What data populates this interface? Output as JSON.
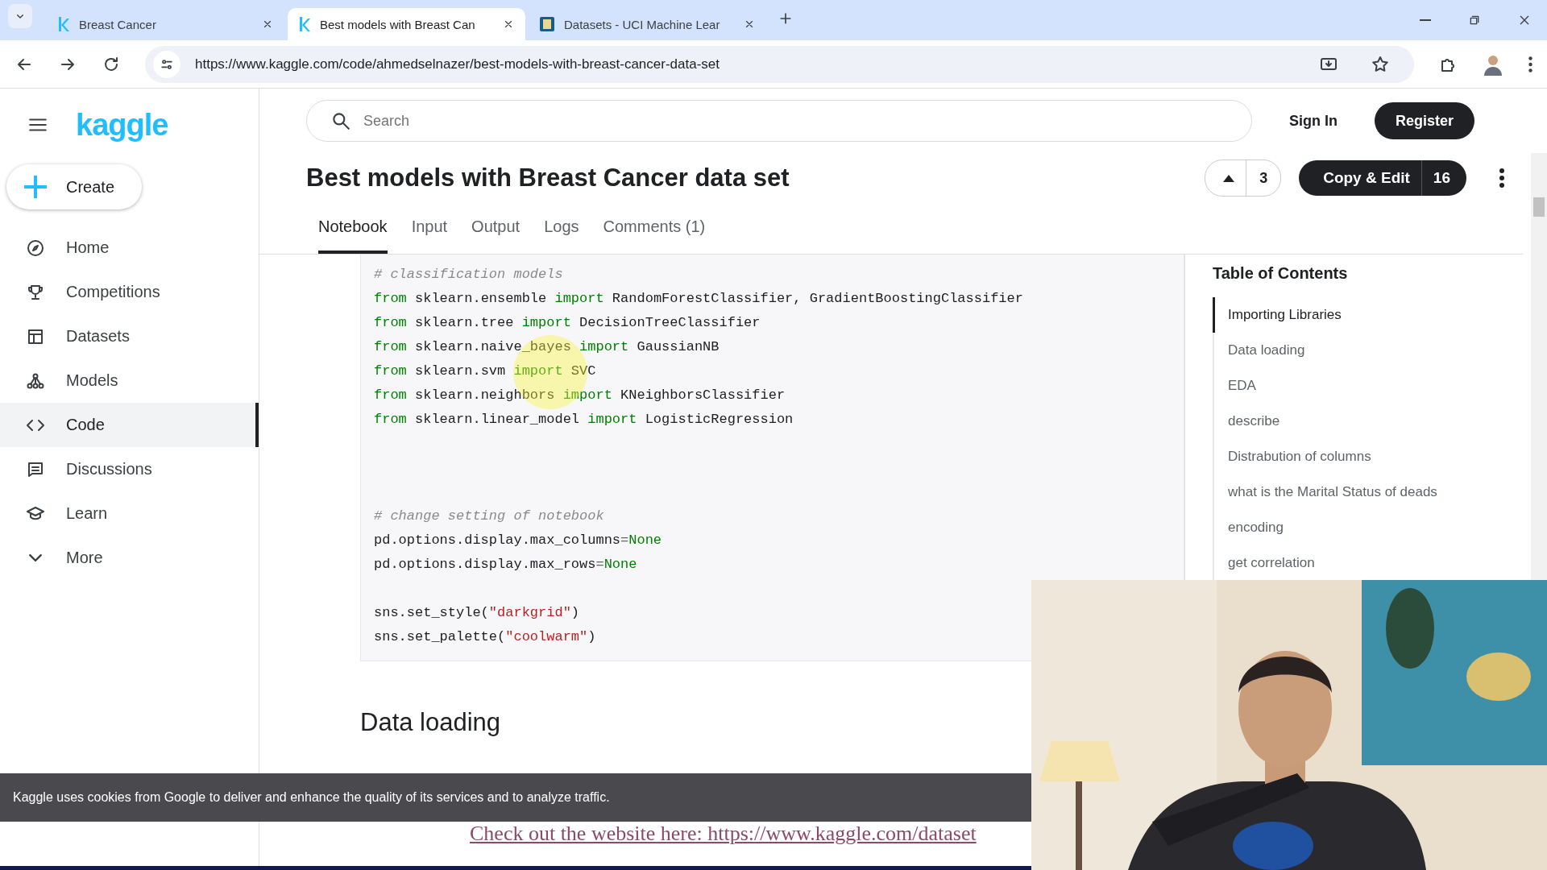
{
  "browser": {
    "tabs": [
      {
        "title": "Breast Cancer",
        "selected": false
      },
      {
        "title": "Best models with Breast Can",
        "selected": true
      },
      {
        "title": "Datasets - UCI Machine Lear",
        "selected": false
      }
    ],
    "url": "https://www.kaggle.com/code/ahmedselnazer/best-models-with-breast-cancer-data-set"
  },
  "sidebar": {
    "logo": "kaggle",
    "create": "Create",
    "items": [
      {
        "label": "Home",
        "selected": false
      },
      {
        "label": "Competitions",
        "selected": false
      },
      {
        "label": "Datasets",
        "selected": false
      },
      {
        "label": "Models",
        "selected": false
      },
      {
        "label": "Code",
        "selected": true
      },
      {
        "label": "Discussions",
        "selected": false
      },
      {
        "label": "Learn",
        "selected": false
      },
      {
        "label": "More",
        "selected": false
      }
    ]
  },
  "header": {
    "search": {
      "placeholder": "Search"
    },
    "sign_in": "Sign In",
    "register": "Register"
  },
  "notebook": {
    "title": "Best models with Breast Cancer data set",
    "votes": "3",
    "copy_edit": "Copy & Edit",
    "copies": "16",
    "tabs": [
      {
        "label": "Notebook",
        "selected": true
      },
      {
        "label": "Input",
        "selected": false
      },
      {
        "label": "Output",
        "selected": false
      },
      {
        "label": "Logs",
        "selected": false
      },
      {
        "label": "Comments (1)",
        "selected": false
      }
    ],
    "code_groups": [
      [
        [
          {
            "kind": "comment",
            "text": "# classification models"
          }
        ],
        [
          {
            "kind": "keyword",
            "text": "from"
          },
          {
            "kind": "plain",
            "text": " sklearn.ensemble "
          },
          {
            "kind": "keyword",
            "text": "import"
          },
          {
            "kind": "plain",
            "text": " RandomForestClassifier, GradientBoostingClassifier"
          }
        ],
        [
          {
            "kind": "keyword",
            "text": "from"
          },
          {
            "kind": "plain",
            "text": " sklearn.tree "
          },
          {
            "kind": "keyword",
            "text": "import"
          },
          {
            "kind": "plain",
            "text": " DecisionTreeClassifier"
          }
        ],
        [
          {
            "kind": "keyword",
            "text": "from"
          },
          {
            "kind": "plain",
            "text": " sklearn.naive_bayes "
          },
          {
            "kind": "keyword",
            "text": "import"
          },
          {
            "kind": "plain",
            "text": " GaussianNB"
          }
        ],
        [
          {
            "kind": "keyword",
            "text": "from"
          },
          {
            "kind": "plain",
            "text": " sklearn.svm "
          },
          {
            "kind": "keyword",
            "text": "import"
          },
          {
            "kind": "plain",
            "text": " SVC"
          }
        ],
        [
          {
            "kind": "keyword",
            "text": "from"
          },
          {
            "kind": "plain",
            "text": " sklearn.neighbors "
          },
          {
            "kind": "keyword",
            "text": "import"
          },
          {
            "kind": "plain",
            "text": " KNeighborsClassifier"
          }
        ],
        [
          {
            "kind": "keyword",
            "text": "from"
          },
          {
            "kind": "plain",
            "text": " sklearn.linear_model "
          },
          {
            "kind": "keyword",
            "text": "import"
          },
          {
            "kind": "plain",
            "text": " LogisticRegression"
          }
        ]
      ],
      [
        [
          {
            "kind": "comment",
            "text": "# change setting of notebook"
          }
        ],
        [
          {
            "kind": "plain",
            "text": "pd.options.display.max_columns"
          },
          {
            "kind": "operator",
            "text": "="
          },
          {
            "kind": "keyword",
            "text": "None"
          }
        ],
        [
          {
            "kind": "plain",
            "text": "pd.options.display.max_rows"
          },
          {
            "kind": "operator",
            "text": "="
          },
          {
            "kind": "keyword",
            "text": "None"
          }
        ]
      ],
      [
        [
          {
            "kind": "plain",
            "text": "sns.set_style("
          },
          {
            "kind": "string",
            "text": "\"darkgrid\""
          },
          {
            "kind": "plain",
            "text": ")"
          }
        ],
        [
          {
            "kind": "plain",
            "text": "sns.set_palette("
          },
          {
            "kind": "string",
            "text": "\"coolwarm\""
          },
          {
            "kind": "plain",
            "text": ")"
          }
        ]
      ]
    ],
    "section_heading": "Data loading",
    "toc": {
      "title": "Table of Contents",
      "items": [
        {
          "label": "Importing Libraries",
          "selected": true
        },
        {
          "label": "Data loading",
          "selected": false
        },
        {
          "label": "EDA",
          "selected": false
        },
        {
          "label": "describe",
          "selected": false
        },
        {
          "label": "Distrabution of columns",
          "selected": false
        },
        {
          "label": "what is the Marital Status of deads",
          "selected": false
        },
        {
          "label": "encoding",
          "selected": false
        },
        {
          "label": "get correlation",
          "selected": false
        }
      ]
    }
  },
  "cookie_banner": "Kaggle uses cookies from Google to deliver and enhance the quality of its services and to analyze traffic.",
  "caption_link": "Check out the website here: https://www.kaggle.com/dataset"
}
